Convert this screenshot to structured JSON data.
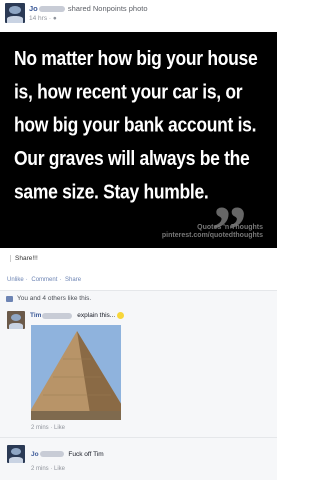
{
  "post": {
    "author": "Jo",
    "action_text": "shared Nonpoints photo",
    "time_text": "14 hrs ·"
  },
  "quote": {
    "text": "No matter how big your house is, how recent your car is, or how big your bank account is. Our graves will always be the same size. Stay humble.",
    "mark": "”",
    "credit_line1": "Quotes 'n Thoughts",
    "credit_line2": "pinterest.com/quotedthoughts"
  },
  "share_message": "Share!!!",
  "actions": {
    "like": "Unlike",
    "comment": "Comment",
    "share": "Share",
    "separator": "·"
  },
  "likes_text": "You and 4 others like this.",
  "comments": [
    {
      "author": "Tim",
      "text": "explain this...",
      "emoji_icon": "smiley-icon",
      "meta": "2 mins · Like"
    },
    {
      "author": "Jo",
      "text": "Fuck off Tim",
      "meta": "2 mins · Like"
    }
  ],
  "colors": {
    "link_blue": "#3b5998",
    "quote_background": "#000000",
    "sky": "#8fb3dd"
  }
}
